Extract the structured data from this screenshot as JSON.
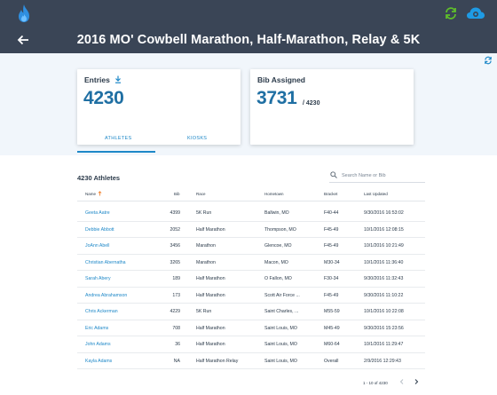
{
  "app": {
    "title": "2016 MO' Cowbell Marathon, Half-Marathon, Relay & 5K",
    "icons": {
      "logo": "flame-icon",
      "sync": "sync-icon",
      "cloud": "cloud-icon",
      "back": "back-arrow-icon",
      "refresh": "refresh-icon"
    },
    "colors": {
      "topbar": "#3a4556",
      "accent": "#1e88c8",
      "value": "#1f6fa3",
      "sync": "#5fbf2a"
    }
  },
  "stats": {
    "entries_label": "Entries",
    "entries_value": "4230",
    "bib_label": "Bib Assigned",
    "bib_value": "3731",
    "bib_total": "/ 4230"
  },
  "tabs": [
    {
      "label": "ATHLETES",
      "active": true
    },
    {
      "label": "KIOSKS",
      "active": false
    }
  ],
  "list": {
    "title": "4230 Athletes",
    "search_placeholder": "Search Name or Bib"
  },
  "table": {
    "headers": {
      "name": "Name",
      "bib": "Bib",
      "race": "Race",
      "hometown": "Hometown",
      "bracket": "Bracket",
      "updated": "Last Updated"
    },
    "rows": [
      {
        "name": "Geeta Aatre",
        "bib": "4399",
        "race": "5K Run",
        "hometown": "Ballwin, MO",
        "bracket": "F40-44",
        "updated": "9/30/2016 16:53:02"
      },
      {
        "name": "Debbie Abbott",
        "bib": "2052",
        "race": "Half Marathon",
        "hometown": "Thompson, MO",
        "bracket": "F45-49",
        "updated": "10/1/2016 12:08:15"
      },
      {
        "name": "JoAnn Abell",
        "bib": "3456",
        "race": "Marathon",
        "hometown": "Glencoe, MO",
        "bracket": "F45-49",
        "updated": "10/1/2016 10:21:49"
      },
      {
        "name": "Christian Abernatha",
        "bib": "3265",
        "race": "Marathon",
        "hometown": "Macon, MO",
        "bracket": "M30-34",
        "updated": "10/1/2016 11:36:40"
      },
      {
        "name": "Sarah Abery",
        "bib": "189",
        "race": "Half Marathon",
        "hometown": "O Fallon, MO",
        "bracket": "F30-34",
        "updated": "9/30/2016 11:32:43"
      },
      {
        "name": "Andrea Abrahamson",
        "bib": "173",
        "race": "Half Marathon",
        "hometown": "Scott Air Force ...",
        "bracket": "F45-49",
        "updated": "9/30/2016 11:10:22"
      },
      {
        "name": "Chris Ackerman",
        "bib": "4229",
        "race": "5K Run",
        "hometown": "Saint Charles, ...",
        "bracket": "M55-59",
        "updated": "10/1/2016 10:22:08"
      },
      {
        "name": "Eric Adams",
        "bib": "708",
        "race": "Half Marathon",
        "hometown": "Saint Louis, MO",
        "bracket": "M45-49",
        "updated": "9/30/2016 15:23:56"
      },
      {
        "name": "John Adams",
        "bib": "36",
        "race": "Half Marathon",
        "hometown": "Saint Louis, MO",
        "bracket": "M60-64",
        "updated": "10/1/2016 11:29:47"
      },
      {
        "name": "Kayla Adams",
        "bib": "NA",
        "race": "Half Marathon Relay",
        "hometown": "Saint Louis, MO",
        "bracket": "Overall",
        "updated": "2/9/2016 12:29:43"
      }
    ]
  },
  "pager": {
    "label": "1 - 10 of 4230"
  }
}
